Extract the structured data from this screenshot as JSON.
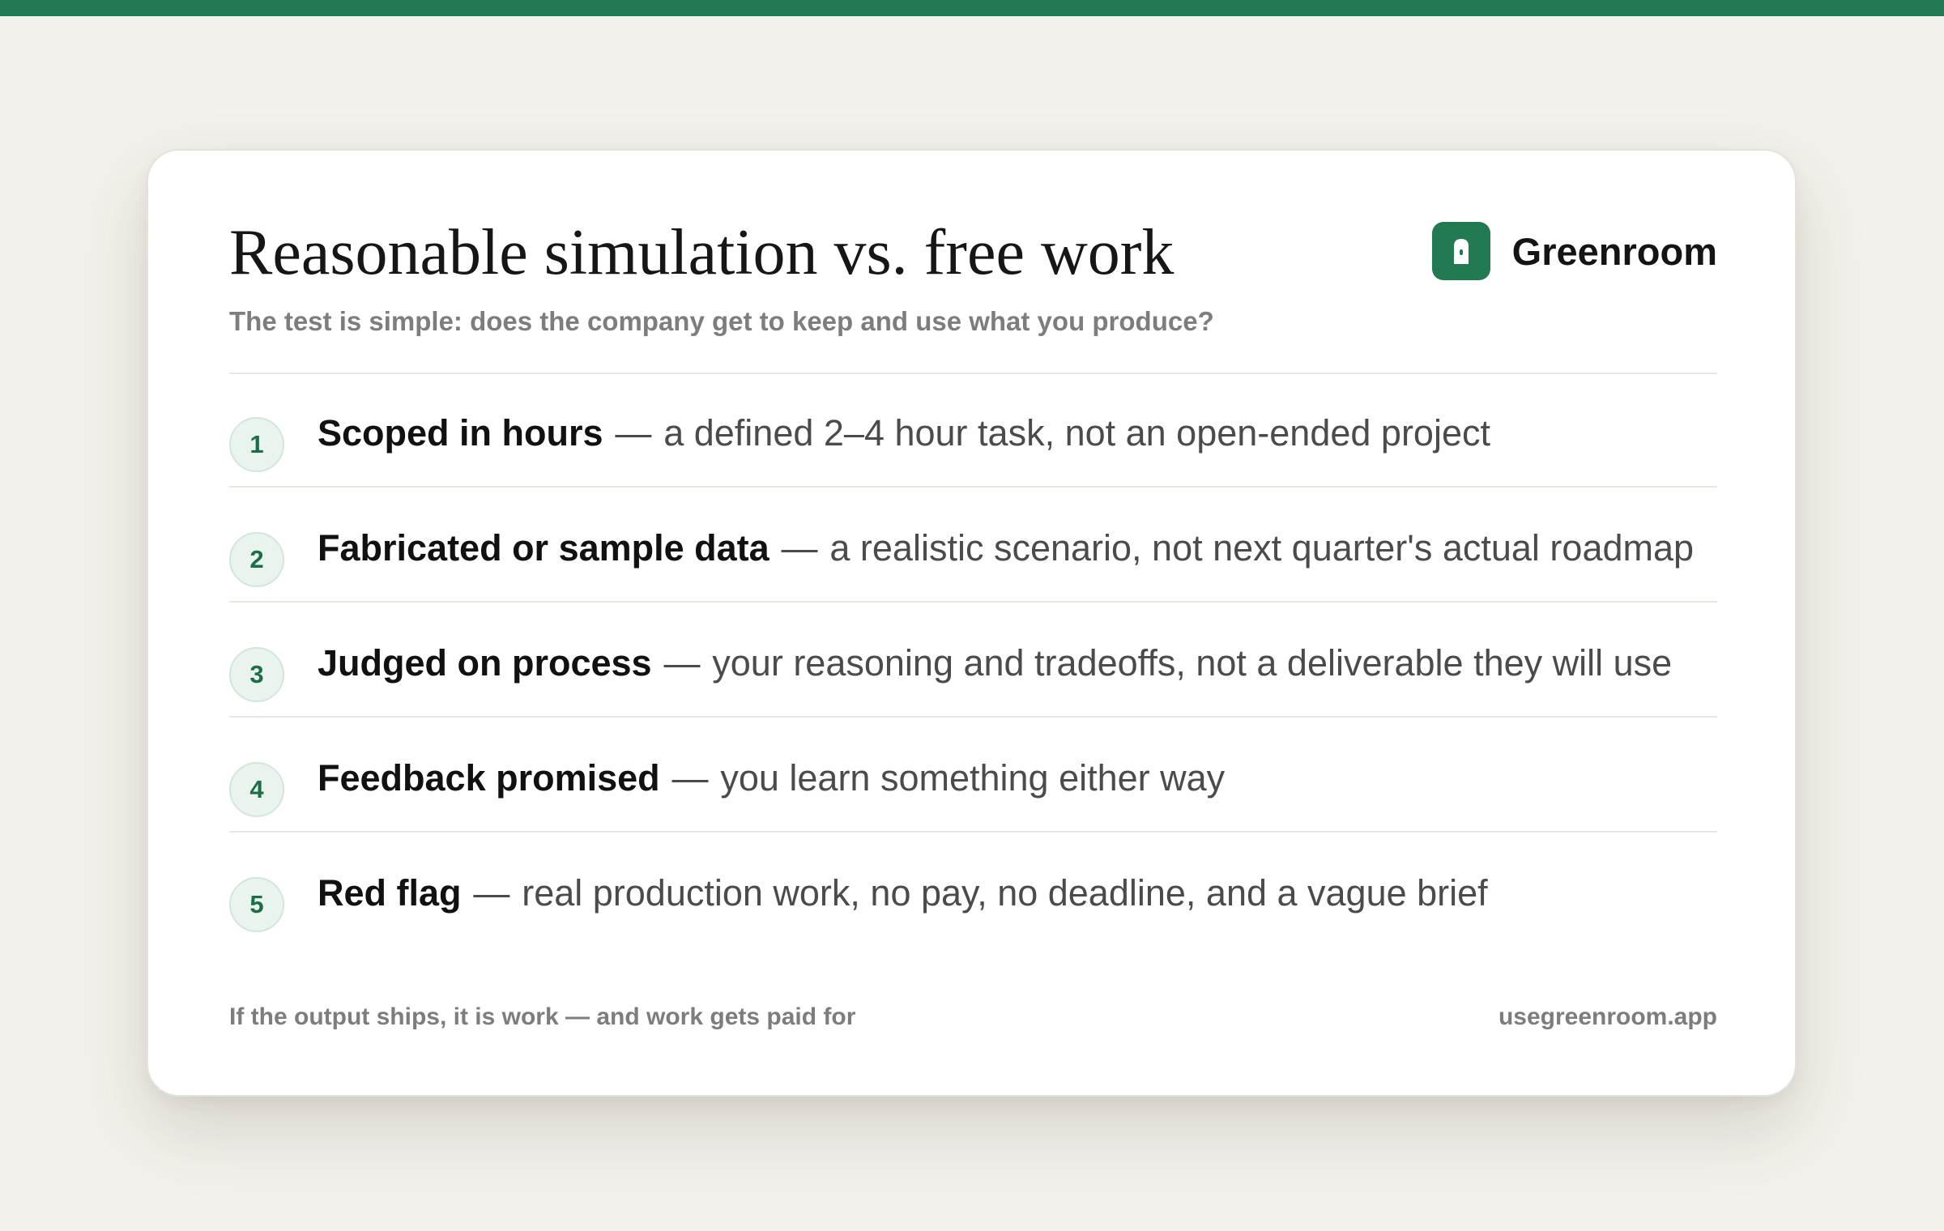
{
  "colors": {
    "accent": "#217a50",
    "background": "#f3f1eb",
    "card": "#ffffff",
    "badge_bg": "#eaf4ee",
    "muted_text": "#7d7d7d"
  },
  "header": {
    "title": "Reasonable simulation vs. free work",
    "subtitle": "The test is simple: does the company get to keep and use what you produce?"
  },
  "brand": {
    "icon": "lock-icon",
    "name": "Greenroom"
  },
  "separator": "—",
  "items": [
    {
      "number": "1",
      "title": "Scoped in hours",
      "description": "a defined 2–4 hour task, not an open-ended project"
    },
    {
      "number": "2",
      "title": "Fabricated or sample data",
      "description": "a realistic scenario, not next quarter's actual roadmap"
    },
    {
      "number": "3",
      "title": "Judged on process",
      "description": "your reasoning and tradeoffs, not a deliverable they will use"
    },
    {
      "number": "4",
      "title": "Feedback promised",
      "description": "you learn something either way"
    },
    {
      "number": "5",
      "title": "Red flag",
      "description": "real production work, no pay, no deadline, and a vague brief"
    }
  ],
  "footer": {
    "tagline": "If the output ships, it is work — and work gets paid for",
    "url": "usegreenroom.app"
  }
}
